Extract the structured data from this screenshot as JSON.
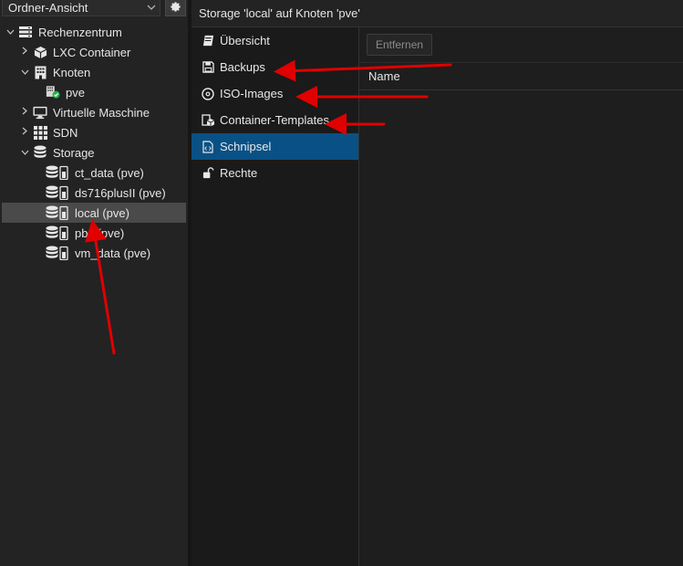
{
  "view_selector": {
    "label": "Ordner-Ansicht"
  },
  "header": {
    "title": "Storage 'local' auf Knoten 'pve'"
  },
  "tree": {
    "datacenter": "Rechenzentrum",
    "lxc": "LXC Container",
    "nodes": "Knoten",
    "node_pve": "pve",
    "vms": "Virtuelle Maschine",
    "sdn": "SDN",
    "storage": "Storage",
    "storage_items": [
      "ct_data (pve)",
      "ds716plusII (pve)",
      "local (pve)",
      "pbs (pve)",
      "vm_data (pve)"
    ]
  },
  "nav": {
    "items": [
      "Übersicht",
      "Backups",
      "ISO-Images",
      "Container-Templates",
      "Schnipsel",
      "Rechte"
    ],
    "active": "Schnipsel"
  },
  "toolbar": {
    "remove_label": "Entfernen"
  },
  "grid": {
    "columns": [
      "Name"
    ]
  },
  "colors": {
    "accent": "#095185",
    "annotation_arrow": "#e00000",
    "status_ok": "#22b14c"
  }
}
